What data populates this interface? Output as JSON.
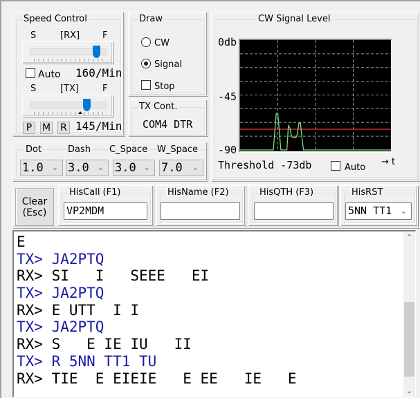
{
  "speed_control": {
    "title": "Speed Control",
    "rx": {
      "label": "[RX]",
      "slow": "S",
      "fast": "F",
      "value_fraction": 0.86
    },
    "auto_label": "Auto",
    "auto_checked": false,
    "rx_speed": "160/Min",
    "tx": {
      "label": "[TX]",
      "slow": "S",
      "fast": "F",
      "value_fraction": 0.74
    },
    "buttons": [
      "P",
      "M",
      "R"
    ],
    "tx_speed": "145/Min"
  },
  "draw": {
    "title": "Draw",
    "options": [
      {
        "label": "CW",
        "checked": false
      },
      {
        "label": "Signal",
        "checked": true
      }
    ],
    "stop_label": "Stop",
    "stop_checked": false
  },
  "tx_cont": {
    "title": "TX Cont.",
    "value": "COM4 DTR"
  },
  "timing": {
    "fields": [
      {
        "label": "Dot",
        "value": "1.0"
      },
      {
        "label": "Dash",
        "value": "3.0"
      },
      {
        "label": "C_Space",
        "value": "3.0"
      },
      {
        "label": "W_Space",
        "value": "7.0"
      }
    ]
  },
  "signal_level": {
    "title": "CW Signal Level",
    "y_labels": [
      "0db",
      "-45",
      "-90"
    ],
    "threshold_label": "Threshold -73db",
    "threshold_db": -73,
    "auto_label": "Auto",
    "auto_checked": false,
    "time_axis_label": "→ t",
    "colors": {
      "signal": "#7ee07e",
      "threshold": "#c03030",
      "background": "#000000"
    }
  },
  "chart_data": {
    "type": "line",
    "title": "CW Signal Level",
    "xlabel": "→ t",
    "ylabel": "",
    "ylim": [
      -90,
      0
    ],
    "yticks": [
      0,
      -45,
      -90
    ],
    "grid": true,
    "threshold": -73,
    "x": [
      0,
      20,
      22,
      23,
      24,
      25,
      26,
      27,
      28,
      29,
      30,
      31,
      32,
      33,
      34,
      35,
      36,
      37,
      38,
      39,
      40,
      41,
      42,
      43,
      44,
      45,
      46,
      47,
      100
    ],
    "series": [
      {
        "name": "Signal",
        "values": [
          -90,
          -90,
          -90,
          -75,
          -60,
          -60,
          -75,
          -90,
          -90,
          -90,
          -90,
          -90,
          -70,
          -72,
          -78,
          -80,
          -80,
          -80,
          -77,
          -68,
          -68,
          -80,
          -90,
          -90,
          -90,
          -90,
          -90,
          -90,
          -90
        ]
      }
    ]
  },
  "clear_button": {
    "line1": "Clear",
    "line2": "(Esc)"
  },
  "his_call": {
    "label": "HisCall (F1)",
    "value": "VP2MDM"
  },
  "his_name": {
    "label": "HisName (F2)",
    "value": ""
  },
  "his_qth": {
    "label": "HisQTH (F3)",
    "value": ""
  },
  "his_rst": {
    "label": "HisRST",
    "value": "5NN TT1"
  },
  "log": {
    "tx_color": "#1a1aa6",
    "rx_color": "#000000",
    "lines": [
      {
        "type": "rx",
        "text": "E"
      },
      {
        "type": "tx",
        "text": "TX> JA2PTQ"
      },
      {
        "type": "rx",
        "text": "RX> SI   I   SEEE   EI"
      },
      {
        "type": "tx",
        "text": "TX> JA2PTQ"
      },
      {
        "type": "rx",
        "text": "RX> E UTT  I I"
      },
      {
        "type": "tx",
        "text": "TX> JA2PTQ"
      },
      {
        "type": "rx",
        "text": "RX> S   E IE IU   II"
      },
      {
        "type": "tx",
        "text": "TX> R 5NN TT1 TU"
      },
      {
        "type": "rx",
        "text": "RX> TIE  E EIEIE   E EE   IE   E"
      }
    ]
  }
}
